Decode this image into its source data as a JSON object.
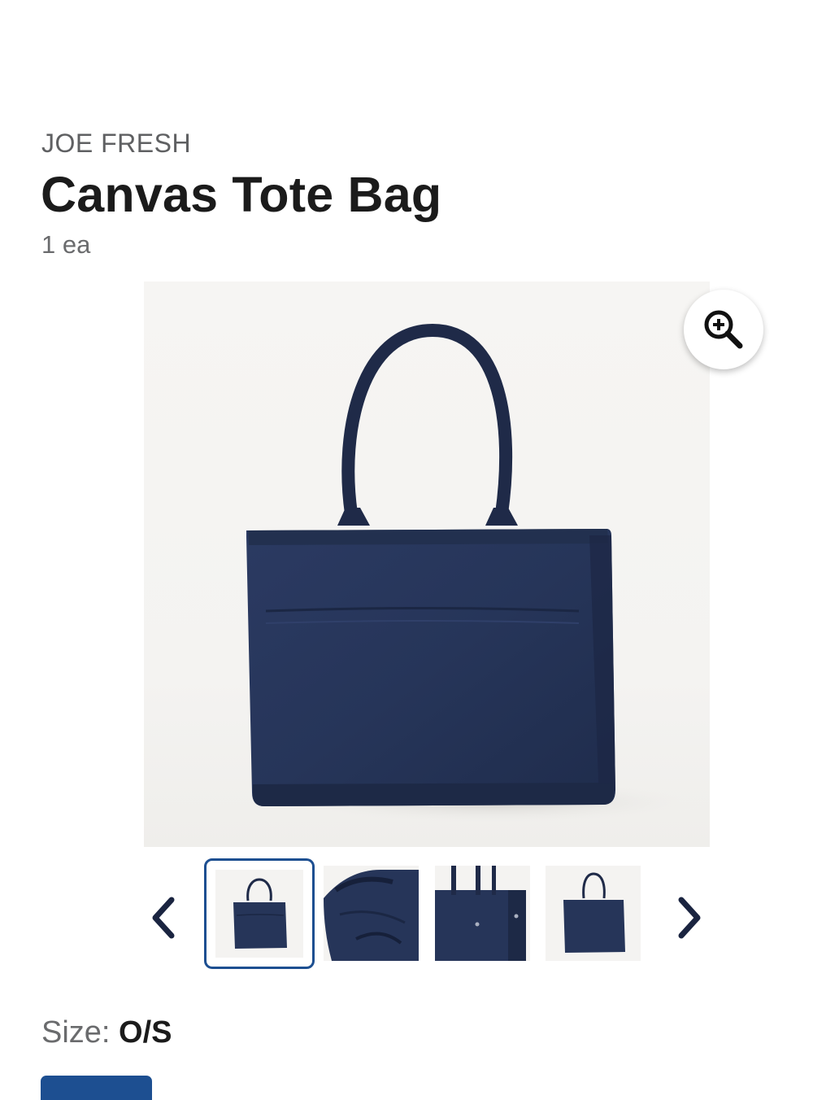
{
  "product": {
    "brand": "JOE FRESH",
    "name": "Canvas Tote Bag",
    "unit": "1 ea"
  },
  "gallery": {
    "main_image": "tote-bag-front-image",
    "zoom_icon": "zoom-in-icon",
    "prev_icon": "chevron-left-icon",
    "next_icon": "chevron-right-icon",
    "thumbnails": [
      {
        "name": "tote-front",
        "selected": true
      },
      {
        "name": "tote-open-top",
        "selected": false
      },
      {
        "name": "tote-side",
        "selected": false
      },
      {
        "name": "tote-front-small",
        "selected": false
      }
    ]
  },
  "size": {
    "label": "Size: ",
    "value": "O/S"
  },
  "colors": {
    "accent": "#1d4f91",
    "bag": "#263559",
    "text_primary": "#1b1b1b",
    "text_secondary": "#6a6b6d"
  }
}
